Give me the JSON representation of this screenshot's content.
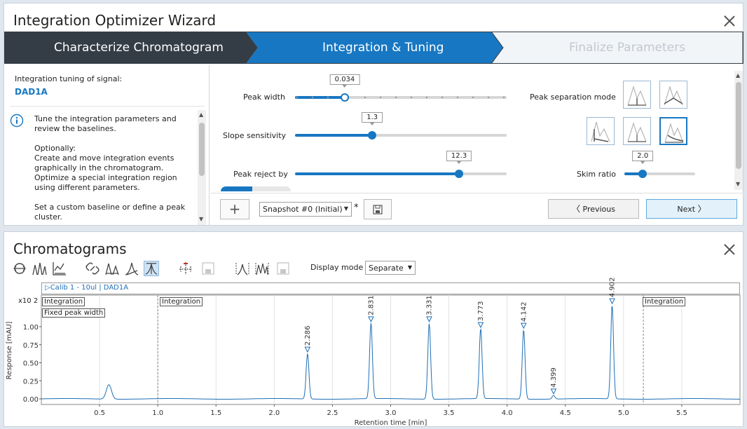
{
  "wizard": {
    "title": "Integration Optimizer Wizard",
    "steps": [
      {
        "label": "Characterize Chromatogram"
      },
      {
        "label": "Integration & Tuning"
      },
      {
        "label": "Finalize Parameters"
      }
    ],
    "signal_label": "Integration tuning of signal:",
    "signal_name": "DAD1A",
    "info_lines": [
      "Tune the integration parameters and",
      "review the baselines.",
      "",
      "Optionally:",
      "Create and move integration events",
      "graphically in the chromatogram.",
      "Optimize a special integration region",
      "using different parameters.",
      "",
      "Set a custom baseline or define a peak",
      "cluster."
    ],
    "params": {
      "peak_width": {
        "label": "Peak width",
        "value": "0.034",
        "level": 0.235
      },
      "slope_sensitivity": {
        "label": "Slope sensitivity",
        "value": "1.3",
        "level": 0.365
      },
      "peak_reject": {
        "label": "Peak reject by",
        "value": "12.3",
        "level": 0.775
      },
      "peak_separation_mode": {
        "label": "Peak separation mode"
      },
      "skim_ratio": {
        "label": "Skim ratio",
        "value": "2.0",
        "level": 0.26
      }
    },
    "snapshot": {
      "value": "Snapshot #0 (Initial)",
      "modified_marker": "*"
    },
    "previous_label": "Previous",
    "next_label": "Next",
    "accent_color": "#1777c2"
  },
  "chromatograms": {
    "title": "Chromatograms",
    "display_mode_label": "Display mode",
    "display_mode_value": "Separate",
    "trace_name": "Calib 1 - 10ul | DAD1A",
    "scale_label": "x10 2",
    "event_labels": {
      "integration_1": "Integration",
      "fixed_peak_width": "Fixed peak width",
      "integration_2": "Integration",
      "integration_3": "Integration"
    }
  },
  "chart_data": {
    "type": "line",
    "xlabel": "Retention time [min]",
    "ylabel": "Response [mAU]",
    "xlim": [
      0,
      6.0
    ],
    "ylim": [
      -0.05,
      1.3
    ],
    "x_ticks": [
      "0.5",
      "1.0",
      "1.5",
      "2.0",
      "2.5",
      "3.0",
      "3.5",
      "4.0",
      "4.5",
      "5.0",
      "5.5"
    ],
    "y_ticks": [
      "0.00",
      "0.25",
      "0.50",
      "0.75",
      "1.00"
    ],
    "event_lines_x": [
      1.0,
      5.17
    ],
    "peaks": [
      {
        "rt": 0.58,
        "height": 0.2,
        "label": ""
      },
      {
        "rt": 2.286,
        "height": 0.63,
        "label": "2.286"
      },
      {
        "rt": 2.831,
        "height": 1.05,
        "label": "2.831"
      },
      {
        "rt": 3.331,
        "height": 1.05,
        "label": "3.331"
      },
      {
        "rt": 3.773,
        "height": 0.97,
        "label": "3.773"
      },
      {
        "rt": 4.142,
        "height": 0.96,
        "label": "4.142"
      },
      {
        "rt": 4.399,
        "height": 0.05,
        "label": "4.399"
      },
      {
        "rt": 4.902,
        "height": 1.3,
        "label": "4.902"
      }
    ],
    "series_color": "#1f6fb5"
  }
}
